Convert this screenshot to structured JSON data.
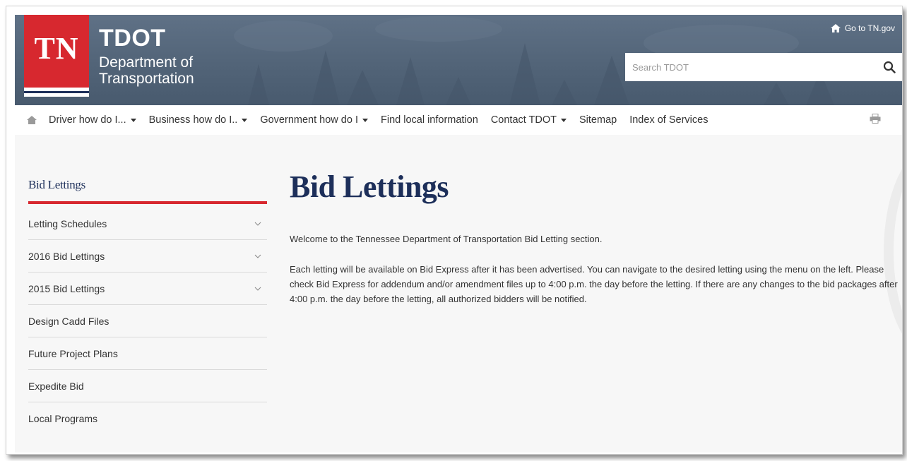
{
  "header": {
    "logo_mark": "TN",
    "brand_name": "TDOT",
    "brand_sub": "Department of Transportation",
    "goto_link": "Go to TN.gov",
    "search_placeholder": "Search TDOT",
    "icons": [
      "home-icon",
      "search-icon"
    ]
  },
  "nav": {
    "items": [
      {
        "label": "Driver how do I...",
        "has_caret": true
      },
      {
        "label": "Business how do I..",
        "has_caret": true
      },
      {
        "label": "Government how do I",
        "has_caret": true
      },
      {
        "label": "Find local information",
        "has_caret": false
      },
      {
        "label": "Contact TDOT",
        "has_caret": true
      },
      {
        "label": "Sitemap",
        "has_caret": false
      },
      {
        "label": "Index of Services",
        "has_caret": false
      }
    ],
    "icons": [
      "home-icon",
      "print-icon"
    ]
  },
  "sidebar": {
    "title": "Bid Lettings",
    "items": [
      {
        "label": "Letting Schedules",
        "expandable": true
      },
      {
        "label": "2016 Bid Lettings",
        "expandable": true
      },
      {
        "label": "2015 Bid Lettings",
        "expandable": true
      },
      {
        "label": "Design Cadd Files",
        "expandable": false
      },
      {
        "label": "Future Project Plans",
        "expandable": false
      },
      {
        "label": "Expedite Bid",
        "expandable": false
      },
      {
        "label": "Local Programs",
        "expandable": false
      }
    ]
  },
  "main": {
    "title": "Bid Lettings",
    "paragraph1": "Welcome to the Tennessee Department of  Transportation Bid Letting section.",
    "paragraph2": "Each letting will be available on Bid Express after it has been advertised. You can navigate to the desired letting using the menu on the left. Please check Bid Express for addendum and/or amendment files up to 4:00 p.m. the day before the letting. If there are any changes to the bid packages after 4:00 p.m. the day before the letting, all authorized bidders will be notified."
  },
  "colors": {
    "brand_red": "#d7282f",
    "navy": "#1d2f5a",
    "banner": "#526478"
  }
}
